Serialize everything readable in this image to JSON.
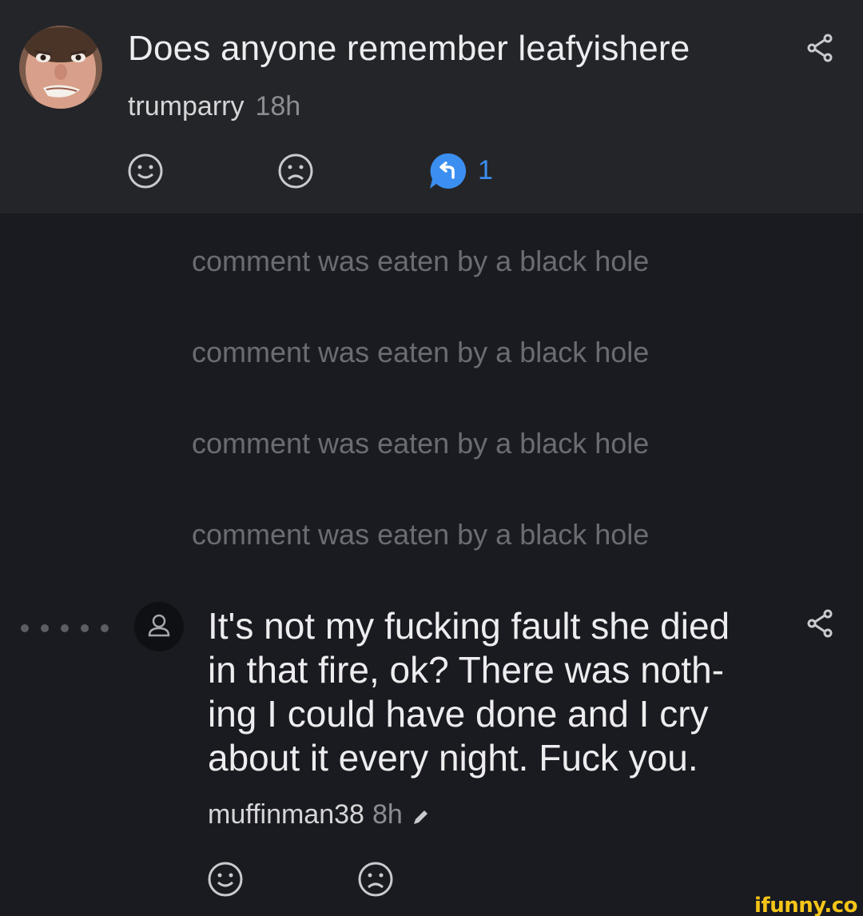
{
  "post": {
    "title": "Does anyone remember leafyishere",
    "author": "trumparry",
    "age": "18h",
    "reply_count": "1",
    "icons": {
      "avatar": "user-photo-avatar",
      "share": "share-icon",
      "like": "smile-icon",
      "dislike": "frown-icon",
      "replies": "reply-bubble-icon"
    }
  },
  "deleted_comments": [
    "comment was eaten by a black hole",
    "comment was eaten by a black hole",
    "comment was eaten by a black hole",
    "comment was eaten by a black hole"
  ],
  "comment": {
    "lines": [
      "It's not my fucking fault she died",
      "in that fire, ok? There was noth-",
      "ing I could have done and I cry",
      "about it every night. Fuck you."
    ],
    "author": "muffinman38",
    "age": "8h",
    "icons": {
      "avatar": "default-user-icon",
      "edited": "pencil-icon",
      "share": "share-icon"
    }
  },
  "watermark": "ifunny.co",
  "colors": {
    "background": "#1a1b20",
    "header": "#242529",
    "accent": "#3b8ff0",
    "muted": "#6b6c72",
    "watermark": "#f5c518"
  }
}
